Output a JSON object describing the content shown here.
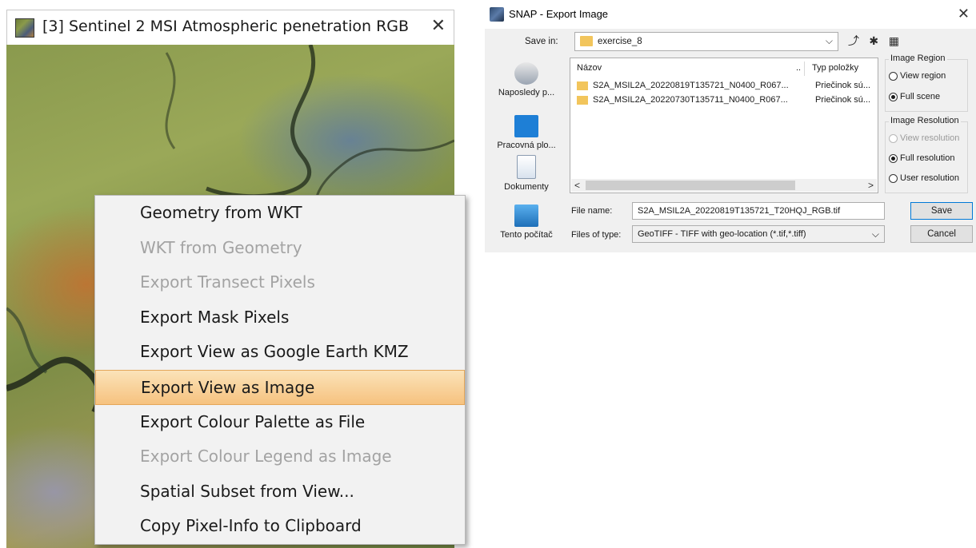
{
  "view_tab": {
    "title": "[3] Sentinel 2 MSI Atmospheric penetration RGB",
    "close": "✕"
  },
  "context_menu": {
    "items": [
      {
        "label": "Geometry from WKT",
        "state": "enabled"
      },
      {
        "label": "WKT from Geometry",
        "state": "disabled"
      },
      {
        "label": "Export Transect Pixels",
        "state": "disabled"
      },
      {
        "label": "Export Mask Pixels",
        "state": "enabled"
      },
      {
        "label": "Export View as Google Earth KMZ",
        "state": "enabled"
      },
      {
        "label": "Export View as Image",
        "state": "highlighted"
      },
      {
        "label": "Export Colour Palette as File",
        "state": "enabled"
      },
      {
        "label": "Export Colour Legend as Image",
        "state": "disabled"
      },
      {
        "label": "Spatial Subset from View...",
        "state": "enabled"
      },
      {
        "label": "Copy Pixel-Info to Clipboard",
        "state": "enabled"
      }
    ]
  },
  "dialog": {
    "title": "SNAP - Export Image",
    "close": "✕",
    "save_in_label": "Save in:",
    "save_in_value": "exercise_8",
    "places": [
      {
        "label": "Naposledy p...",
        "icon": "recent-places-icon"
      },
      {
        "label": "Pracovná plo...",
        "icon": "desktop-icon"
      },
      {
        "label": "Dokumenty",
        "icon": "documents-icon"
      },
      {
        "label": "Tento počítač",
        "icon": "this-pc-icon"
      }
    ],
    "file_list": {
      "col_name": "Názov",
      "col_sep": "..",
      "col_type": "Typ položky",
      "rows": [
        {
          "name": "S2A_MSIL2A_20220819T135721_N0400_R067...",
          "type": "Priečinok sú..."
        },
        {
          "name": "S2A_MSIL2A_20220730T135711_N0400_R067...",
          "type": "Priečinok sú..."
        }
      ]
    },
    "image_region": {
      "title": "Image Region",
      "options": [
        {
          "label": "View region",
          "selected": false,
          "enabled": true
        },
        {
          "label": "Full scene",
          "selected": true,
          "enabled": true
        }
      ]
    },
    "image_resolution": {
      "title": "Image Resolution",
      "options": [
        {
          "label": "View resolution",
          "selected": false,
          "enabled": false
        },
        {
          "label": "Full resolution",
          "selected": true,
          "enabled": true
        },
        {
          "label": "User resolution",
          "selected": false,
          "enabled": true
        }
      ]
    },
    "file_name_label": "File name:",
    "file_name_value": "S2A_MSIL2A_20220819T135721_T20HQJ_RGB.tif",
    "file_type_label": "Files of type:",
    "file_type_value": "GeoTIFF - TIFF with geo-location (*.tif,*.tiff)",
    "save_label": "Save",
    "cancel_label": "Cancel"
  },
  "colors": {
    "menu_highlight": "#f6c27f",
    "folder": "#f2c55c",
    "accent_border": "#0078d7"
  }
}
